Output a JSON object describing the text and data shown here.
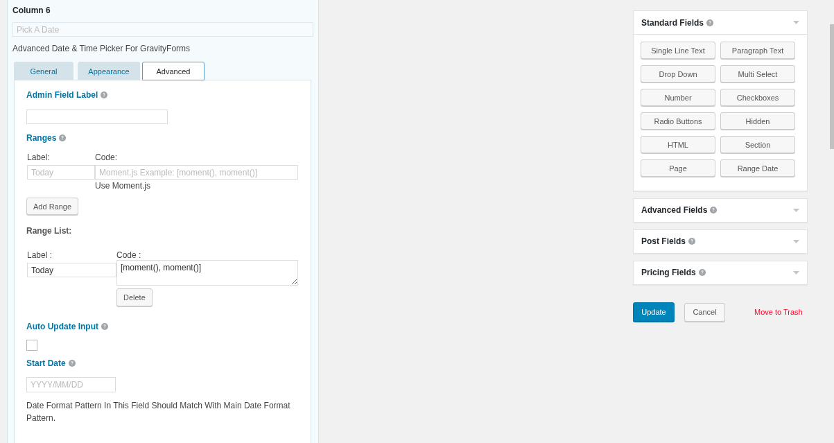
{
  "field": {
    "title": "Column 6",
    "placeholder": "Pick A Date",
    "description": "Advanced Date & Time Picker For GravityForms"
  },
  "tabs": [
    {
      "label": "General",
      "selected": false
    },
    {
      "label": "Appearance",
      "selected": false
    },
    {
      "label": "Advanced",
      "selected": true
    }
  ],
  "advanced_settings": {
    "admin_field_label": {
      "label": "Admin Field Label"
    },
    "ranges": {
      "label": "Ranges",
      "label_heading": "Label:",
      "code_heading": "Code:",
      "label_placeholder": "Today",
      "code_placeholder": "Moment.js Example: [moment(), moment()]",
      "hint": "Use Moment.js",
      "add_button": "Add Range"
    },
    "range_list": {
      "title": "Range List:",
      "label_heading": "Label :",
      "code_heading": "Code :",
      "items": [
        {
          "label": "Today",
          "code": "[moment(), moment()]",
          "delete_button": "Delete"
        }
      ]
    },
    "auto_update_input": {
      "label": "Auto Update Input",
      "checked": false
    },
    "start_date": {
      "label": "Start Date",
      "placeholder": "YYYY/MM/DD",
      "note": "Date Format Pattern In This Field Should Match With Main Date Format Pattern."
    }
  },
  "field_groups": [
    {
      "title": "Standard Fields",
      "expanded": true,
      "buttons": [
        "Single Line Text",
        "Paragraph Text",
        "Drop Down",
        "Multi Select",
        "Number",
        "Checkboxes",
        "Radio Buttons",
        "Hidden",
        "HTML",
        "Section",
        "Page",
        "Range Date"
      ]
    },
    {
      "title": "Advanced Fields",
      "expanded": false
    },
    {
      "title": "Post Fields",
      "expanded": false
    },
    {
      "title": "Pricing Fields",
      "expanded": false
    }
  ],
  "actions": {
    "update": "Update",
    "cancel": "Cancel",
    "trash": "Move to Trash"
  }
}
